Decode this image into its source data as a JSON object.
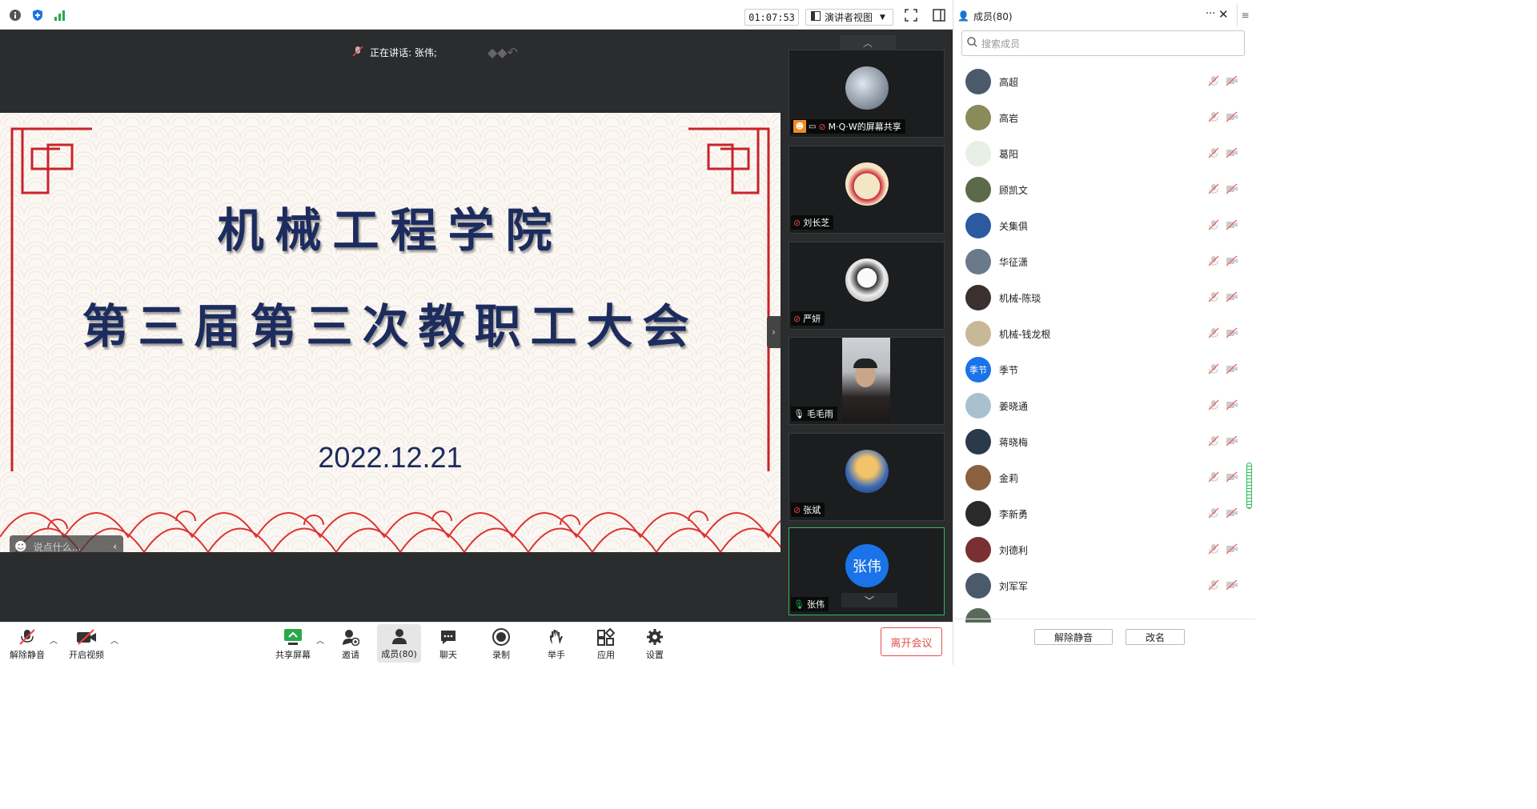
{
  "titlebar": {
    "timer": "01:07:53",
    "view_mode": "演讲者视图"
  },
  "stage": {
    "speaking_label": "正在讲话: 张伟;",
    "chat_placeholder": "说点什么..."
  },
  "slide": {
    "line1": "机械工程学院",
    "line2": "第三届第三次教职工大会",
    "date": "2022.12.21"
  },
  "gallery": {
    "tiles": [
      {
        "name": "M·Q·W的屏幕共享"
      },
      {
        "name": "刘长芝"
      },
      {
        "name": "严妍"
      },
      {
        "name": "毛毛雨"
      },
      {
        "name": "张斌"
      },
      {
        "name": "张伟",
        "avatar_text": "张伟"
      }
    ]
  },
  "toolbar": {
    "unmute": "解除静音",
    "start_video": "开启视频",
    "share": "共享屏幕",
    "invite": "邀请",
    "members": "成员(80)",
    "chat": "聊天",
    "record": "录制",
    "raise_hand": "举手",
    "apps": "应用",
    "settings": "设置",
    "leave": "离开会议"
  },
  "panel": {
    "title": "成员(80)",
    "search_placeholder": "搜索成员",
    "members": [
      {
        "name": "高超",
        "color": "#4a5a6a"
      },
      {
        "name": "高岩",
        "color": "#8a8a5a"
      },
      {
        "name": "葛阳",
        "color": "#e8efe4"
      },
      {
        "name": "顾凯文",
        "color": "#5d6a4a"
      },
      {
        "name": "关集俱",
        "color": "#2c5aa0"
      },
      {
        "name": "华征潇",
        "color": "#6a7a8a"
      },
      {
        "name": "机械-陈琰",
        "color": "#3a3030"
      },
      {
        "name": "机械-钱龙根",
        "color": "#c8b898"
      },
      {
        "name": "季节",
        "color": "#1a73e8",
        "avatar_text": "季节"
      },
      {
        "name": "姜晓通",
        "color": "#a8c0d0"
      },
      {
        "name": "蒋晓梅",
        "color": "#2a3a4a"
      },
      {
        "name": "金莉",
        "color": "#8a6040"
      },
      {
        "name": "李新勇",
        "color": "#2a2a2a"
      },
      {
        "name": "刘德利",
        "color": "#7a3030"
      },
      {
        "name": "刘军军",
        "color": "#4a5a6a"
      }
    ],
    "unmute_all": "解除静音",
    "rename": "改名"
  }
}
